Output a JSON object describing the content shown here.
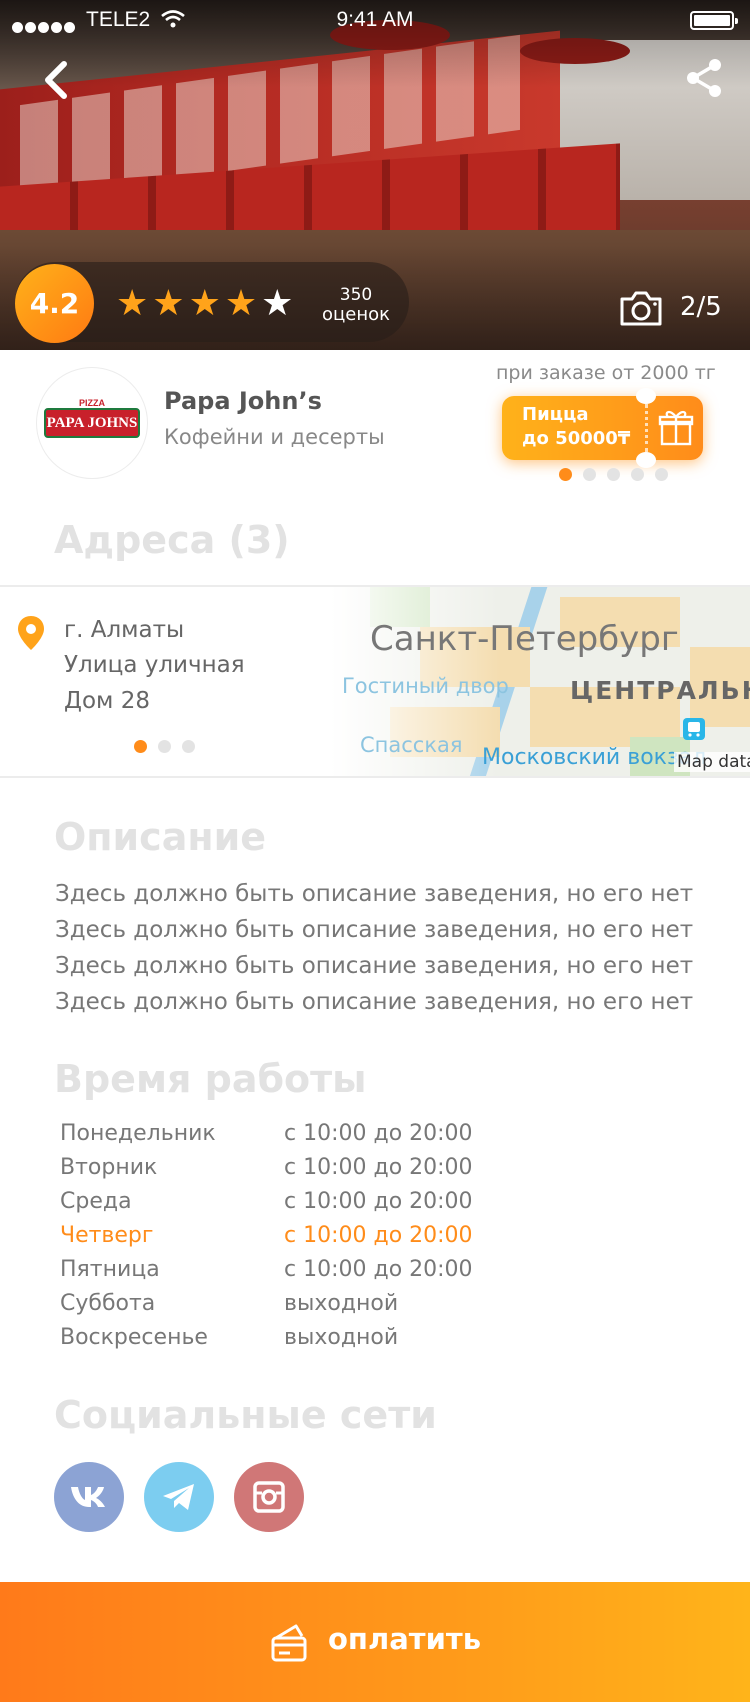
{
  "status_bar": {
    "carrier": "TELE2",
    "time": "9:41 AM"
  },
  "hero": {
    "rating": "4.2",
    "stars_filled": 4,
    "stars_total": 5,
    "reviews_count": "350",
    "reviews_label": "оценок",
    "photo_counter": "2/5"
  },
  "venue": {
    "logo_text": "PAPA JOHNS",
    "logo_small": "PIZZA",
    "name": "Papa John’s",
    "category": "Кофейни и десерты"
  },
  "promo": {
    "caption": "при заказе от 2000 тг",
    "line1": "Пицца",
    "line2": "до 50000₸",
    "dots_total": 5,
    "dots_active": 0
  },
  "addresses": {
    "title": "Адреса (3)",
    "city": "г. Алматы",
    "street": "Улица уличная",
    "house": "Дом 28",
    "dots_total": 3,
    "dots_active": 0,
    "map_labels": {
      "city": "Санкт-Петербург",
      "gostiny": "Гостиный двор",
      "center": "ЦЕНТРАЛЬН",
      "spasskaya": "Спасская",
      "moskovsky": "Московский вокзал",
      "attribution": "Map data"
    }
  },
  "description": {
    "title": "Описание",
    "lines": [
      "Здесь должно быть описание заведения, но его нет",
      "Здесь должно быть описание заведения, но его нет",
      "Здесь должно быть описание заведения, но его нет",
      "Здесь должно быть описание заведения, но его нет"
    ]
  },
  "hours": {
    "title": "Время работы",
    "rows": [
      {
        "day": "Понедельник",
        "time": "с 10:00 до 20:00",
        "active": false
      },
      {
        "day": "Вторник",
        "time": "с 10:00 до 20:00",
        "active": false
      },
      {
        "day": "Среда",
        "time": "с 10:00 до 20:00",
        "active": false
      },
      {
        "day": "Четверг",
        "time": "с 10:00 до 20:00",
        "active": true
      },
      {
        "day": "Пятница",
        "time": "с 10:00 до 20:00",
        "active": false
      },
      {
        "day": "Суббота",
        "time": "выходной",
        "active": false
      },
      {
        "day": "Воскресенье",
        "time": "выходной",
        "active": false
      }
    ],
    "active_color": "#ff8c1a"
  },
  "social": {
    "title": "Социальные сети",
    "items": [
      {
        "icon": "vk-icon",
        "color": "#8ca3d4"
      },
      {
        "icon": "telegram-icon",
        "color": "#7ccdf0"
      },
      {
        "icon": "instagram-icon",
        "color": "#d07777"
      }
    ]
  },
  "pay_button": {
    "label": "оплатить"
  },
  "colors": {
    "accent": "#ff8c1a",
    "heading_muted": "#e2e2e2"
  }
}
